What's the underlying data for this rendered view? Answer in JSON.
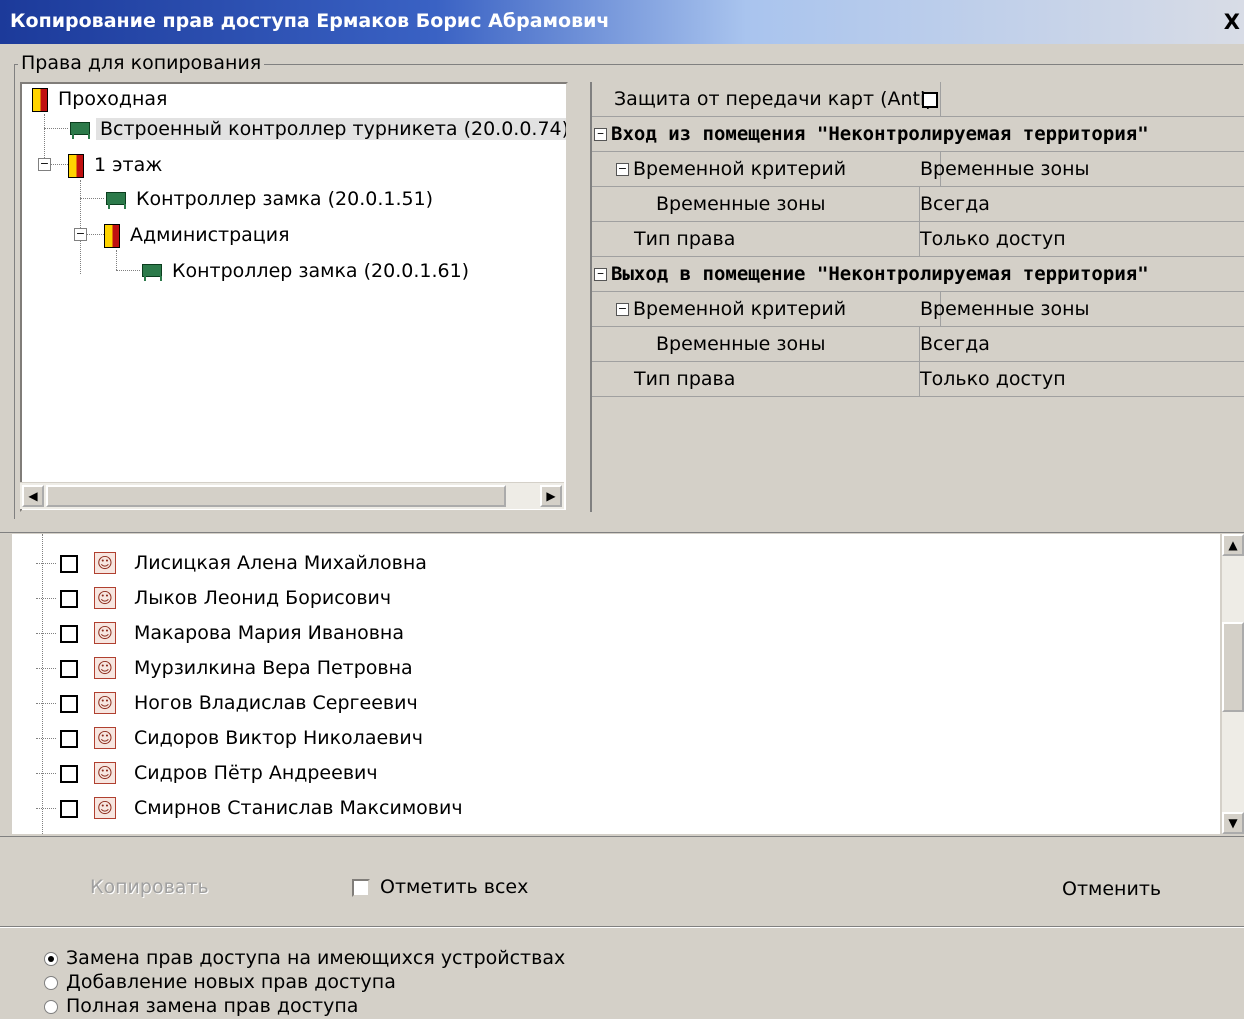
{
  "window": {
    "title": "Копирование прав доступа Ермаков Борис Абрамович",
    "close_glyph": "X"
  },
  "group_label": "Права для копирования",
  "tree": {
    "nodes": [
      {
        "label": "Проходная",
        "icon": "door-icon"
      },
      {
        "label": "Встроенный контроллер турникета (20.0.0.74)",
        "icon": "controller-icon",
        "selected": true
      },
      {
        "label": "1 этаж",
        "icon": "door-icon",
        "expander": "−"
      },
      {
        "label": "Контроллер замка (20.0.1.51)",
        "icon": "controller-icon"
      },
      {
        "label": "Администрация",
        "icon": "door-icon",
        "expander": "−"
      },
      {
        "label": "Контроллер замка (20.0.1.61)",
        "icon": "controller-icon"
      }
    ]
  },
  "properties": {
    "top_row": "Защита от передачи карт (Antip",
    "section1_title": "Вход из помещения \"Неконтролируемая территория\"",
    "section2_title": "Выход в помещение \"Неконтролируемая территория\"",
    "rows": [
      {
        "key": "Временной критерий",
        "value": "Временные зоны"
      },
      {
        "key": "Временные зоны",
        "value": "Всегда"
      },
      {
        "key": "Тип права",
        "value": "Только доступ"
      }
    ],
    "expander_glyph": "−"
  },
  "employees": [
    "Лисицкая Алена Михайловна",
    "Лыков Леонид Борисович",
    "Макарова Мария Ивановна",
    "Мурзилкина Вера Петровна",
    "Ногов Владислав Сергеевич",
    "Сидоров Виктор Николаевич",
    "Сидров Пётр Андреевич",
    "Смирнов Станислав Максимович"
  ],
  "buttons": {
    "copy": "Копировать",
    "select_all": "Отметить всех",
    "cancel": "Отменить"
  },
  "modes": [
    {
      "label": "Замена прав доступа на имеющихся устройствах",
      "selected": true
    },
    {
      "label": "Добавление новых прав доступа",
      "selected": false
    },
    {
      "label": "Полная замена прав доступа",
      "selected": false
    }
  ]
}
